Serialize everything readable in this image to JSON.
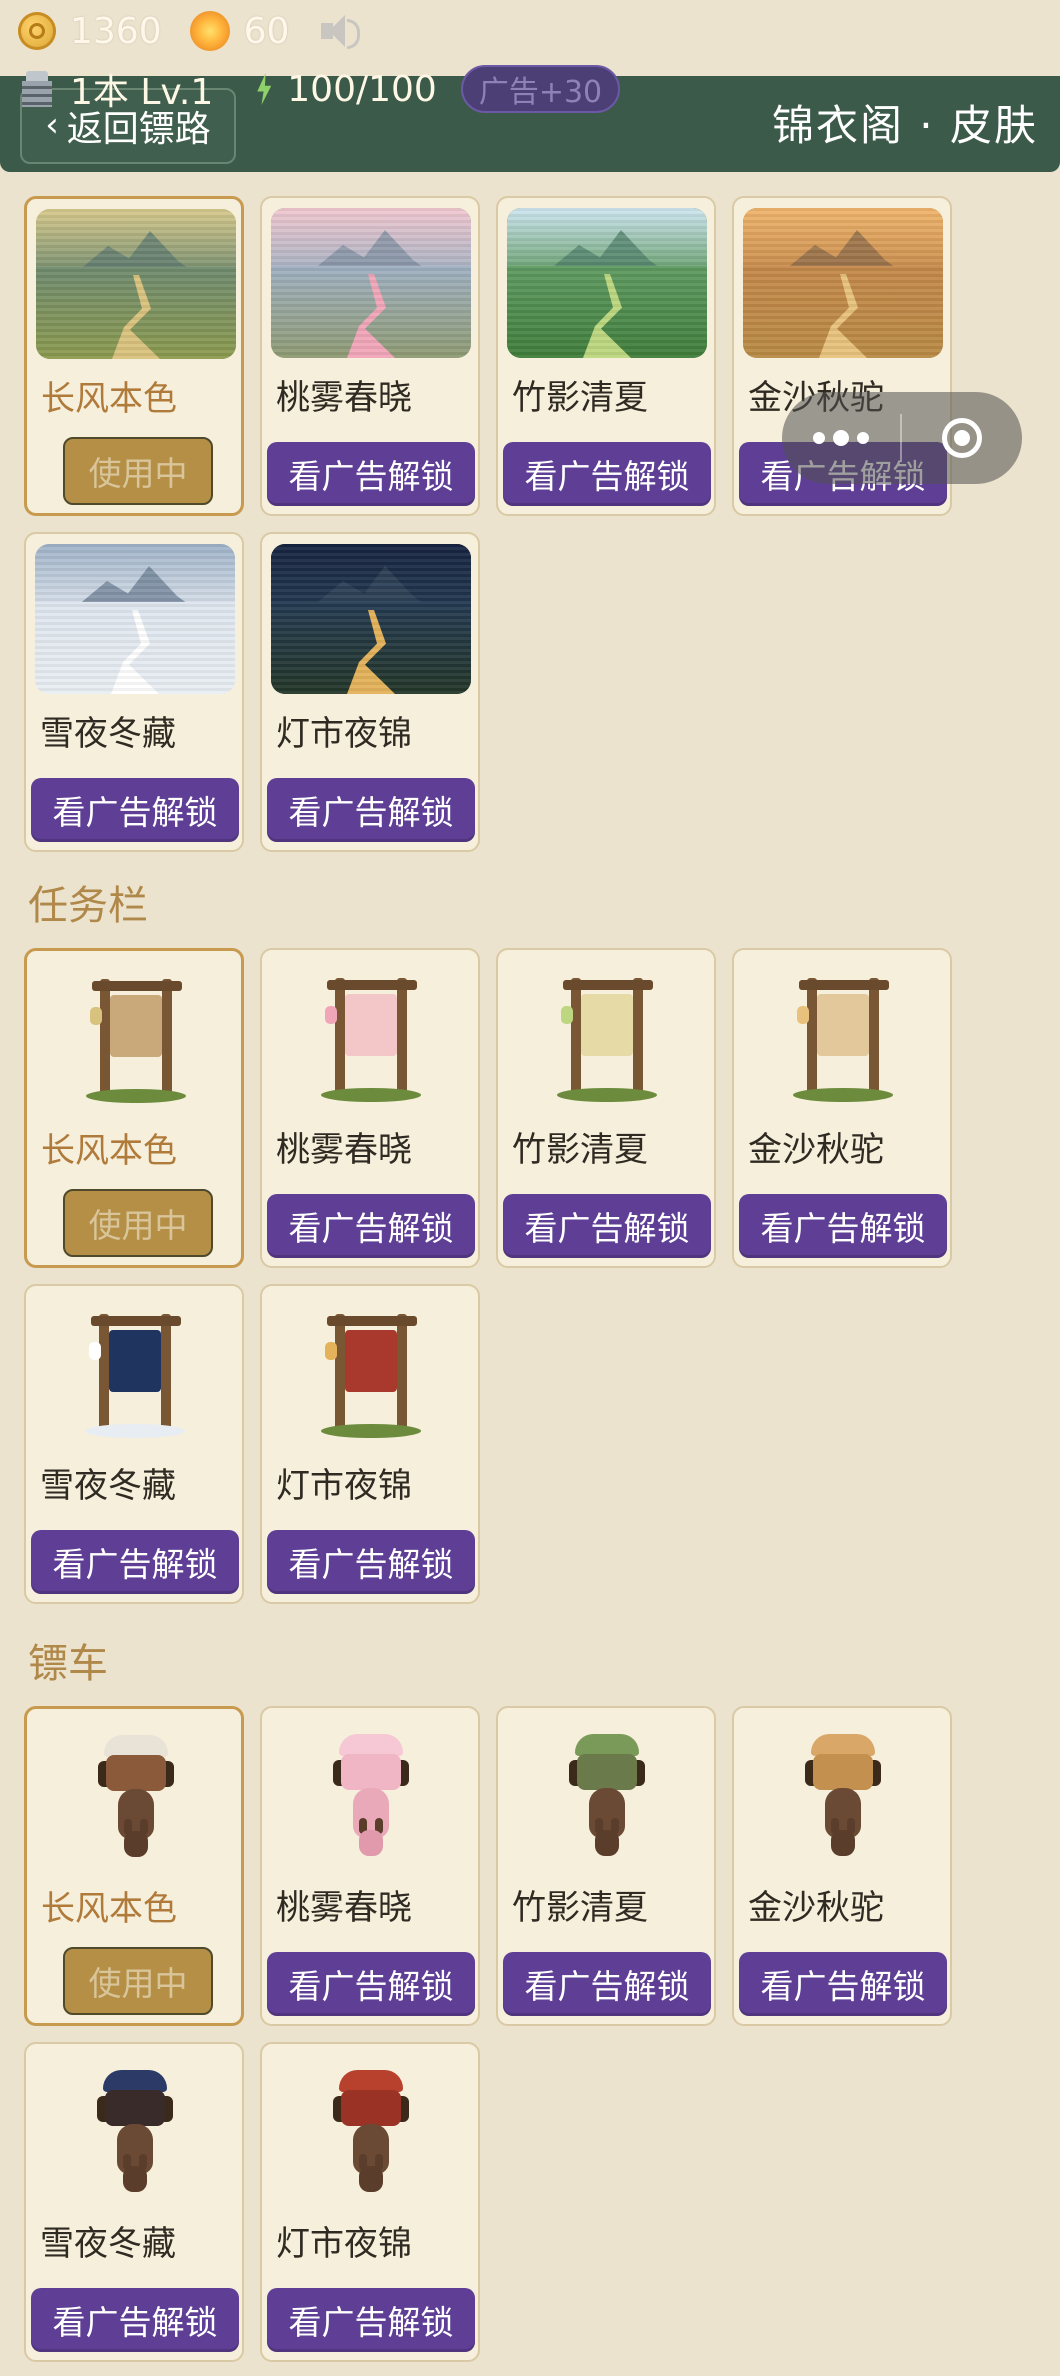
{
  "status": {
    "coins": "1360",
    "gems": "60"
  },
  "player": {
    "stage": "1本 Lv.1",
    "energy": "100/100",
    "ad_bonus": "广告+30"
  },
  "header": {
    "back_label": "返回镖路",
    "title": "锦衣阁 · 皮肤"
  },
  "sections": [
    {
      "title": "",
      "kind": "road",
      "items": [
        {
          "name": "长风本色",
          "button": "使用中",
          "active": true
        },
        {
          "name": "桃雾春晓",
          "button": "看广告解锁",
          "active": false
        },
        {
          "name": "竹影清夏",
          "button": "看广告解锁",
          "active": false
        },
        {
          "name": "金沙秋驼",
          "button": "看广告解锁",
          "active": false
        },
        {
          "name": "雪夜冬藏",
          "button": "看广告解锁",
          "active": false
        },
        {
          "name": "灯市夜锦",
          "button": "看广告解锁",
          "active": false
        }
      ]
    },
    {
      "title": "任务栏",
      "kind": "board",
      "items": [
        {
          "name": "长风本色",
          "button": "使用中",
          "active": true
        },
        {
          "name": "桃雾春晓",
          "button": "看广告解锁",
          "active": false
        },
        {
          "name": "竹影清夏",
          "button": "看广告解锁",
          "active": false
        },
        {
          "name": "金沙秋驼",
          "button": "看广告解锁",
          "active": false
        },
        {
          "name": "雪夜冬藏",
          "button": "看广告解锁",
          "active": false
        },
        {
          "name": "灯市夜锦",
          "button": "看广告解锁",
          "active": false
        }
      ]
    },
    {
      "title": "镖车",
      "kind": "cart",
      "items": [
        {
          "name": "长风本色",
          "button": "使用中",
          "active": true
        },
        {
          "name": "桃雾春晓",
          "button": "看广告解锁",
          "active": false
        },
        {
          "name": "竹影清夏",
          "button": "看广告解锁",
          "active": false
        },
        {
          "name": "金沙秋驼",
          "button": "看广告解锁",
          "active": false
        },
        {
          "name": "雪夜冬藏",
          "button": "看广告解锁",
          "active": false
        },
        {
          "name": "灯市夜锦",
          "button": "看广告解锁",
          "active": false
        }
      ]
    }
  ],
  "themes": [
    {
      "sky": "#d7c98c",
      "sky2": "#6f8a6e",
      "ground": "#8b9a4e",
      "accent": "#d9c27e",
      "mount": "#5d7a70"
    },
    {
      "sky": "#f2c8d0",
      "sky2": "#9fb0c2",
      "ground": "#8e9a72",
      "accent": "#f0a6b8",
      "mount": "#7f8fa0"
    },
    {
      "sky": "#cfe6f2",
      "sky2": "#5f9a62",
      "ground": "#3f7d3a",
      "accent": "#bcd780",
      "mount": "#4f7f6a"
    },
    {
      "sky": "#f0b56c",
      "sky2": "#c4884a",
      "ground": "#b88a44",
      "accent": "#e8c27c",
      "mount": "#8a6a4a"
    },
    {
      "sky": "#9fb2c8",
      "sky2": "#dfe6ee",
      "ground": "#e9eef3",
      "accent": "#ffffff",
      "mount": "#6b7d93"
    },
    {
      "sky": "#172440",
      "sky2": "#243a52",
      "ground": "#233628",
      "accent": "#e3b25a",
      "mount": "#33465a"
    }
  ]
}
